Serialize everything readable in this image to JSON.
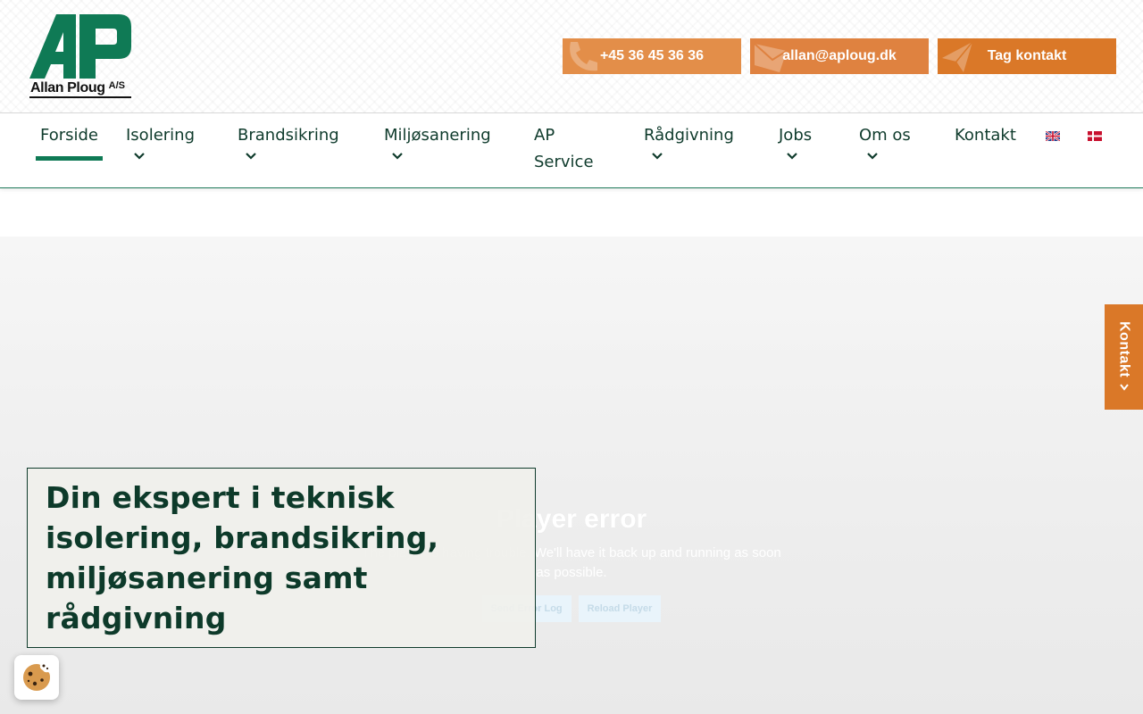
{
  "logo": {
    "mark_letters": "AP",
    "company_name": "Allan Ploug",
    "company_suffix": "A/S"
  },
  "contact_bar": {
    "phone": "+45 36 45 36 36",
    "email": "allan@aploug.dk",
    "contact_label": "Tag kontakt"
  },
  "nav": {
    "items": [
      {
        "label": "Forside",
        "has_dropdown": false,
        "active": true
      },
      {
        "label": "Isolering",
        "has_dropdown": true
      },
      {
        "label": "Brandsikring",
        "has_dropdown": true
      },
      {
        "label": "Miljøsanering",
        "has_dropdown": true
      },
      {
        "label": "AP Service",
        "has_dropdown": false
      },
      {
        "label": "Rådgivning",
        "has_dropdown": true
      },
      {
        "label": "Jobs",
        "has_dropdown": true
      },
      {
        "label": "Om os",
        "has_dropdown": true
      },
      {
        "label": "Kontakt",
        "has_dropdown": false
      }
    ],
    "languages": [
      "english-flag",
      "danish-flag"
    ]
  },
  "player": {
    "title": "Player error",
    "message": "The player is having trouble. We'll have it back up and running as soon as possible.",
    "buttons": [
      "Send Error Log",
      "Reload Player"
    ]
  },
  "hero": {
    "title": "Din ekspert i teknisk isolering, brandsikring, miljøsanering samt rådgivning"
  },
  "side_tab": {
    "label": "Kontakt"
  },
  "colors": {
    "brand_green": "#0f7a55",
    "dark_green": "#0d3a2a",
    "orange": "#da7828"
  }
}
